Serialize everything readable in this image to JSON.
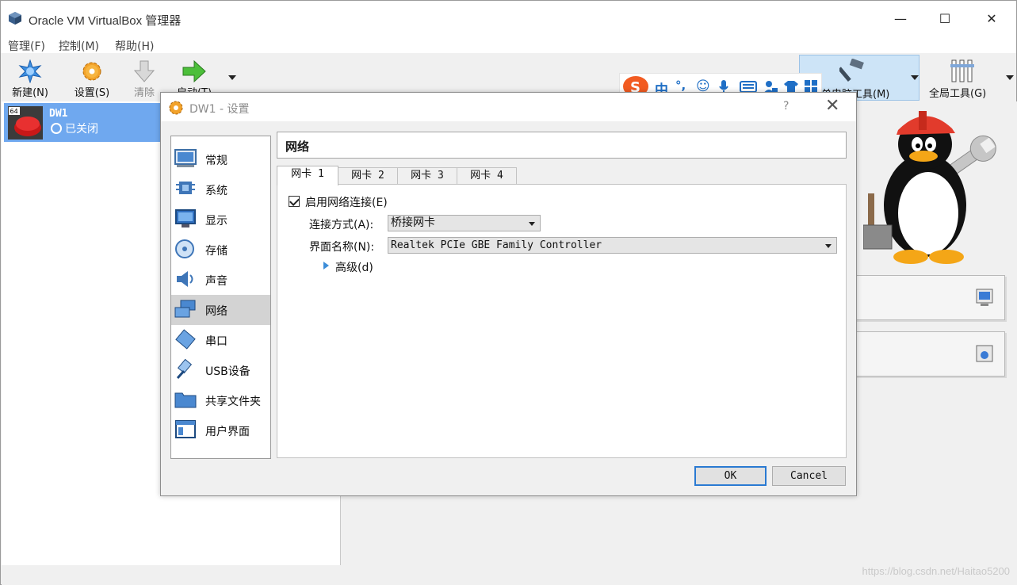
{
  "window": {
    "title": "Oracle VM VirtualBox 管理器",
    "minimize": "—",
    "maximize": "☐",
    "close": "✕"
  },
  "menu": [
    "管理(F)",
    "控制(M)",
    "帮助(H)"
  ],
  "toolbar": {
    "new_label": "新建(N)",
    "settings_label": "设置(S)",
    "discard_label": "清除",
    "start_label": "启动(T)",
    "machine_tools_label": "单电脑工具(M)",
    "global_tools_label": "全局工具(G)"
  },
  "vm_list": [
    {
      "name": "DW1",
      "state": "已关闭",
      "badge": "64"
    }
  ],
  "ime": {
    "items": [
      "中",
      "°,",
      "☺",
      "mic",
      "keyboard",
      "user",
      "shirt",
      "apps"
    ]
  },
  "dialog": {
    "title": "DW1 - 设置",
    "help": "?",
    "close": "✕",
    "categories": [
      {
        "label": "常规",
        "icon": "monitor-general-icon"
      },
      {
        "label": "系统",
        "icon": "chip-icon"
      },
      {
        "label": "显示",
        "icon": "display-icon"
      },
      {
        "label": "存储",
        "icon": "disk-icon"
      },
      {
        "label": "声音",
        "icon": "speaker-icon"
      },
      {
        "label": "网络",
        "icon": "network-icon",
        "selected": true
      },
      {
        "label": "串口",
        "icon": "serial-port-icon"
      },
      {
        "label": "USB设备",
        "icon": "usb-icon"
      },
      {
        "label": "共享文件夹",
        "icon": "folder-icon"
      },
      {
        "label": "用户界面",
        "icon": "window-ui-icon"
      }
    ],
    "page_title": "网络",
    "tabs": [
      "网卡 1",
      "网卡 2",
      "网卡 3",
      "网卡 4"
    ],
    "active_tab": 0,
    "enable_adapter": {
      "label": "启用网络连接(E)",
      "checked": true
    },
    "attached_to": {
      "label": "连接方式(A):",
      "value": "桥接网卡"
    },
    "name": {
      "label": "界面名称(N):",
      "value": "Realtek PCIe GBE Family Controller"
    },
    "advanced_label": "高级(d)",
    "ok_label": "OK",
    "cancel_label": "Cancel"
  },
  "watermark": "https://blog.csdn.net/Haitao5200"
}
